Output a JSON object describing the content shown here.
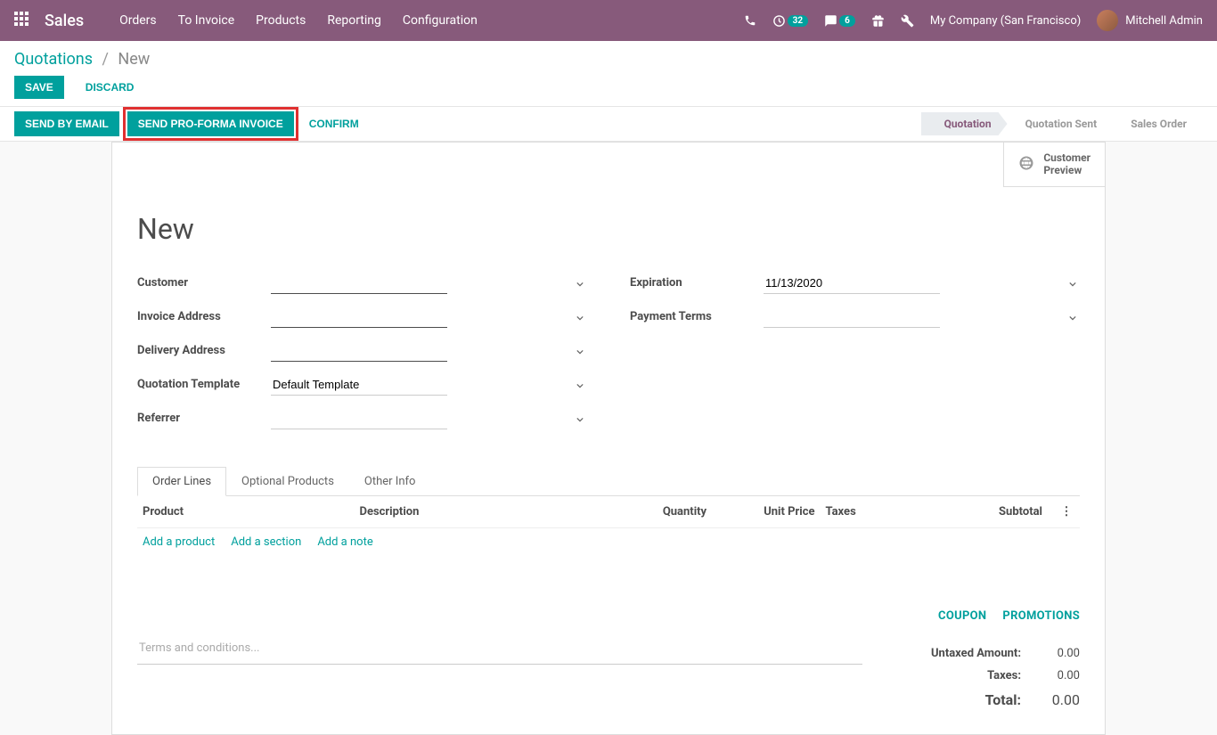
{
  "brand": "Sales",
  "nav": {
    "items": [
      "Orders",
      "To Invoice",
      "Products",
      "Reporting",
      "Configuration"
    ]
  },
  "topright": {
    "activity_badge": "32",
    "chat_badge": "6",
    "company": "My Company (San Francisco)",
    "user": "Mitchell Admin"
  },
  "breadcrumb": {
    "root": "Quotations",
    "current": "New"
  },
  "buttons": {
    "save": "Save",
    "discard": "Discard",
    "send_email": "Send by Email",
    "send_proforma": "Send PRO-FORMA Invoice",
    "confirm": "Confirm"
  },
  "steps": [
    "Quotation",
    "Quotation Sent",
    "Sales Order"
  ],
  "preview": {
    "line1": "Customer",
    "line2": "Preview"
  },
  "title": "New",
  "fields": {
    "customer": {
      "label": "Customer",
      "value": ""
    },
    "invoice_addr": {
      "label": "Invoice Address",
      "value": ""
    },
    "delivery_addr": {
      "label": "Delivery Address",
      "value": ""
    },
    "quotation_tpl": {
      "label": "Quotation Template",
      "value": "Default Template"
    },
    "referrer": {
      "label": "Referrer",
      "value": ""
    },
    "expiration": {
      "label": "Expiration",
      "value": "11/13/2020"
    },
    "payment_terms": {
      "label": "Payment Terms",
      "value": ""
    }
  },
  "tabs": [
    "Order Lines",
    "Optional Products",
    "Other Info"
  ],
  "columns": {
    "product": "Product",
    "description": "Description",
    "quantity": "Quantity",
    "unit_price": "Unit Price",
    "taxes": "Taxes",
    "subtotal": "Subtotal"
  },
  "addline": {
    "product": "Add a product",
    "section": "Add a section",
    "note": "Add a note"
  },
  "terms_placeholder": "Terms and conditions...",
  "promo": {
    "coupon": "COUPON",
    "promotions": "PROMOTIONS"
  },
  "totals": {
    "untaxed_label": "Untaxed Amount:",
    "untaxed_value": "0.00",
    "taxes_label": "Taxes:",
    "taxes_value": "0.00",
    "total_label": "Total:",
    "total_value": "0.00"
  }
}
